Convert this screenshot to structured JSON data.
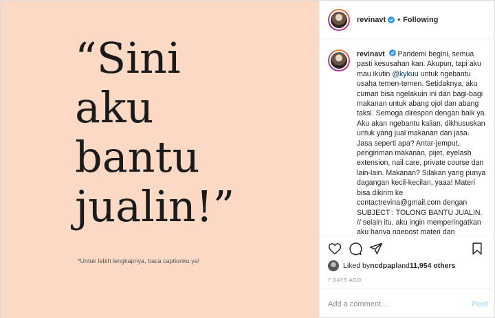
{
  "post": {
    "image": {
      "quote_lines": [
        "“Sini",
        "aku",
        "bantu",
        "jualin!”"
      ],
      "footnote": "*Untuk lebih lengkapnya, baca captionku ya!",
      "background_color": "#fbd9c5"
    },
    "header": {
      "username": "revinavt",
      "separator": "•",
      "follow_status": "Following"
    },
    "caption": {
      "username": "revinavt",
      "text_before_mention": "Pandemi begini, semua pasti kesusahan kan. Akupun, tapi aku mau ikutin ",
      "mention": "@kykuu",
      "text_after_mention": " untuk ngebantu usaha temen-temen. Setidaknya, aku cuman bisa ngelakuin ini dan bagi-bagi makanan untuk abang ojol dan abang taksi. Semoga direspon dengan baik ya. Aku akan ngebantu kalian, dikhususkan untuk yang jual makanan dan jasa. Jasa seperti apa? Antar-jemput, pengiriman makanan, pijet, eyelash extension, nail care, private course dan lain-lain. Makanan? Silakan yang punya dagangan kecil-kecilan, yaaa! Materi bisa dikirim ke contactrevina@gmail.com dengan SUBJECT : TOLONG BANTU JUALIN. // selain itu, aku ingin memperingatkan aku hanya ngepost materi dan"
    },
    "likes": {
      "prefix": "Liked by ",
      "user": "ncdpapl",
      "middle": " and ",
      "count": "11,954 others"
    },
    "timestamp": "7 DAYS AGO",
    "comment": {
      "placeholder": "Add a comment...",
      "post_label": "Post"
    },
    "icons": {
      "like": "heart-icon",
      "comment": "comment-bubble-icon",
      "share": "paper-plane-icon",
      "save": "bookmark-icon",
      "verified": "verified-badge-icon"
    },
    "colors": {
      "mention": "#00376b",
      "verified": "#3897f0",
      "post_button": "#b2dffc",
      "muted": "#8e8e8e"
    }
  }
}
